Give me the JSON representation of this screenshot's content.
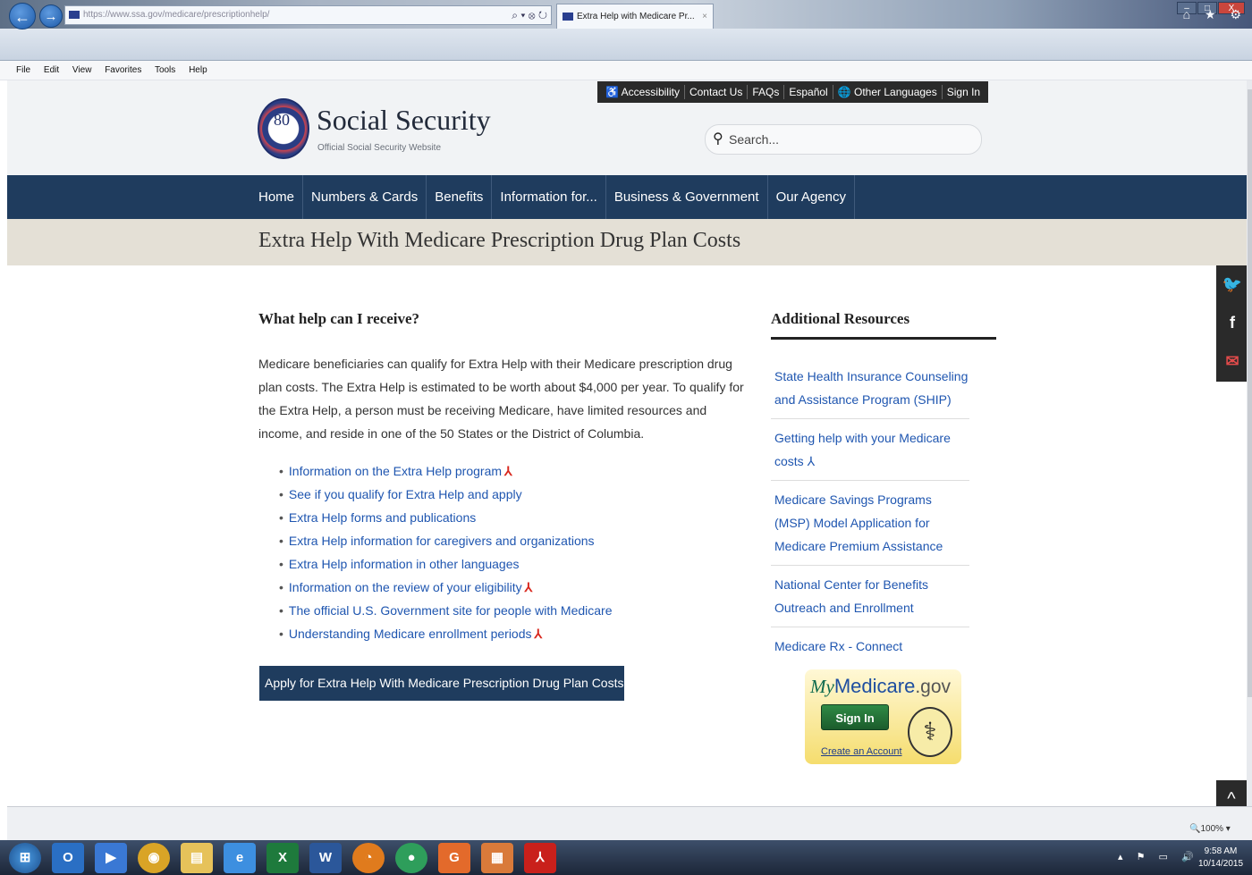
{
  "browser": {
    "url": "https://www.ssa.gov/medicare/prescriptionhelp/",
    "tab_title": "Extra Help with Medicare Pr...",
    "tab_close": "×",
    "menu": [
      "File",
      "Edit",
      "View",
      "Favorites",
      "Tools",
      "Help"
    ],
    "address_icons": "⌕ ▾ ⊗ ↻",
    "toolbar_icons": "⌂ ★ ⚙",
    "window_controls": [
      "–",
      "□",
      "X"
    ],
    "zoom": "🔍100% ▾"
  },
  "header": {
    "seal_text": "80",
    "site_title": "Social Security",
    "site_subtitle": "Official Social Security Website",
    "utility_links": [
      "♿ Accessibility",
      "Contact Us",
      "FAQs",
      "Español",
      "🌐 Other Languages",
      "Sign In"
    ],
    "search_placeholder": "Search..."
  },
  "nav": {
    "items": [
      "Home",
      "Numbers & Cards",
      "Benefits",
      "Information for...",
      "Business & Government",
      "Our Agency"
    ]
  },
  "page": {
    "title": "Extra Help With Medicare Prescription Drug Plan Costs",
    "section_heading": "What help can I receive?",
    "intro": "Medicare beneficiaries can qualify for Extra Help with their Medicare prescription drug plan costs. The Extra Help is estimated to be worth about $4,000 per year. To qualify for the Extra Help, a person must be receiving Medicare, have limited resources and income, and reside in one of the 50 States or the District of Columbia.",
    "links": [
      {
        "label": "Information on the Extra Help program",
        "pdf": "⅄"
      },
      {
        "label": "See if you qualify for Extra Help and apply",
        "pdf": ""
      },
      {
        "label": "Extra Help forms and publications",
        "pdf": ""
      },
      {
        "label": "Extra Help information for caregivers and organizations",
        "pdf": ""
      },
      {
        "label": "Extra Help information in other languages",
        "pdf": ""
      },
      {
        "label": "Information on the review of your eligibility",
        "pdf": "⅄"
      },
      {
        "label": "The official U.S. Government site for people with Medicare",
        "pdf": ""
      },
      {
        "label": "Understanding Medicare enrollment periods",
        "pdf": "⅄"
      }
    ],
    "apply_button": "Apply for Extra Help With Medicare Prescription Drug Plan Costs",
    "bullet": "•"
  },
  "sidebar": {
    "heading": "Additional Resources",
    "resources": [
      "State Health Insurance Counseling and Assistance Program (SHIP)",
      "Getting help with your Medicare costs ⅄",
      "Medicare Savings Programs (MSP) Model Application for Medicare Premium Assistance",
      "National Center for Benefits Outreach and Enrollment",
      "Medicare Rx - Connect"
    ],
    "mymedicare": {
      "my": "My",
      "medicare": "Medicare",
      "gov": ".gov",
      "sign_in": "Sign In",
      "create_account": "Create an Account",
      "seal": "⚕"
    }
  },
  "social": {
    "twitter": "🐦",
    "facebook": "f",
    "email": "✉"
  },
  "back_to_top": "^",
  "taskbar": {
    "icons": [
      "⊞",
      "O",
      "▶",
      "◉",
      "▤",
      "e",
      "X",
      "W",
      "◔",
      "●",
      "G",
      "▦",
      "⅄"
    ],
    "tray": "▴ ⚑ ▭ 🔊",
    "time": "9:58 AM",
    "date": "10/14/2015"
  },
  "colors": {
    "nav_bg": "#1f3c5e",
    "title_band": "#e4e0d6",
    "link": "#1f56b0",
    "pdf": "#d8261c"
  }
}
